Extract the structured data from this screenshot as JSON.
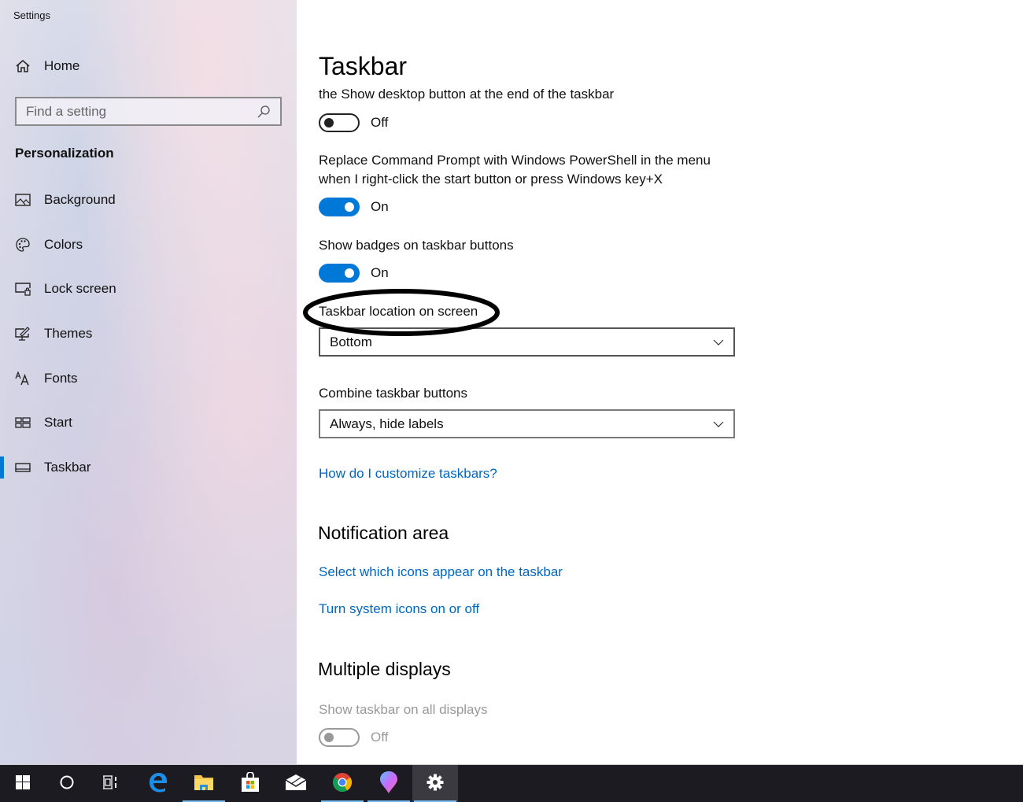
{
  "window": {
    "title": "Settings"
  },
  "sidebar": {
    "home_label": "Home",
    "search_placeholder": "Find a setting",
    "section_label": "Personalization",
    "items": [
      {
        "label": "Background",
        "icon": "picture-icon"
      },
      {
        "label": "Colors",
        "icon": "palette-icon"
      },
      {
        "label": "Lock screen",
        "icon": "lock-screen-icon"
      },
      {
        "label": "Themes",
        "icon": "themes-icon"
      },
      {
        "label": "Fonts",
        "icon": "fonts-icon"
      },
      {
        "label": "Start",
        "icon": "start-icon"
      },
      {
        "label": "Taskbar",
        "icon": "taskbar-icon",
        "active": true
      }
    ]
  },
  "main": {
    "title": "Taskbar",
    "show_desktop": {
      "label": "the Show desktop button at the end of the taskbar",
      "state": "Off"
    },
    "powershell": {
      "label_line1": "Replace Command Prompt with Windows PowerShell in the menu",
      "label_line2": "when I right-click the start button or press Windows key+X",
      "state": "On"
    },
    "badges": {
      "label": "Show badges on taskbar buttons",
      "state": "On"
    },
    "location": {
      "label": "Taskbar location on screen",
      "value": "Bottom"
    },
    "combine": {
      "label": "Combine taskbar buttons",
      "value": "Always, hide labels"
    },
    "help_link": "How do I customize taskbars?",
    "notification_area": {
      "heading": "Notification area",
      "links": [
        "Select which icons appear on the taskbar",
        "Turn system icons on or off"
      ]
    },
    "multiple_displays": {
      "heading": "Multiple displays",
      "show_all": {
        "label": "Show taskbar on all displays",
        "state": "Off",
        "disabled": true
      }
    }
  },
  "colors": {
    "accent": "#0078d7",
    "link": "#0067c0",
    "taskbar_bg": "#1c1b22",
    "running_indicator": "#76b9ed"
  },
  "taskbar": {
    "apps": [
      {
        "name": "start-button",
        "icon": "windows-logo-icon"
      },
      {
        "name": "cortana-button",
        "icon": "cortana-circle-icon"
      },
      {
        "name": "task-view-button",
        "icon": "task-view-icon"
      },
      {
        "name": "edge-button",
        "icon": "edge-icon"
      },
      {
        "name": "file-explorer-button",
        "icon": "folder-icon",
        "running": true
      },
      {
        "name": "store-button",
        "icon": "store-icon"
      },
      {
        "name": "mail-button",
        "icon": "mail-icon"
      },
      {
        "name": "chrome-button",
        "icon": "chrome-icon",
        "running": true
      },
      {
        "name": "paint3d-button",
        "icon": "paint-3d-icon",
        "running": true
      },
      {
        "name": "settings-button",
        "icon": "gear-icon",
        "running": true,
        "active": true
      }
    ]
  }
}
